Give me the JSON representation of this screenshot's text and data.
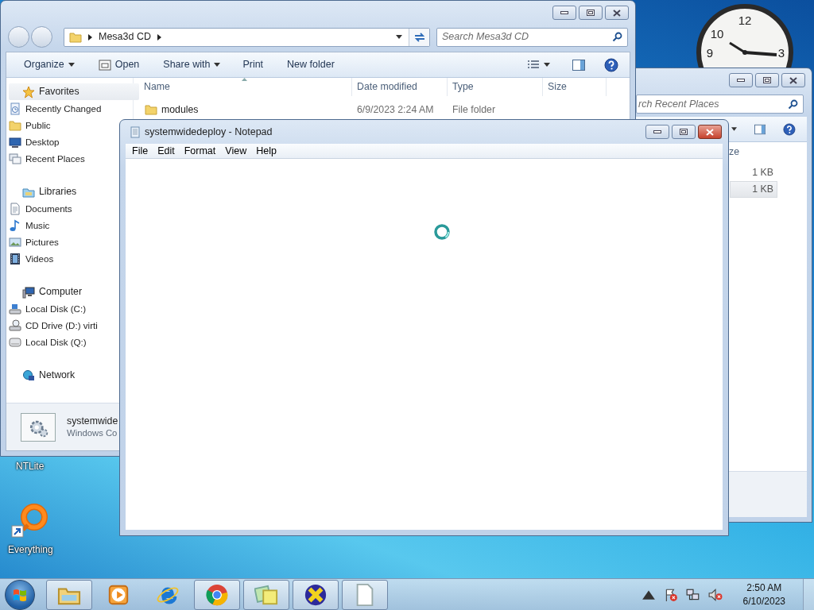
{
  "clock_gadget": {
    "numerals": [
      "12",
      "10",
      "9",
      "3"
    ]
  },
  "explorer": {
    "address": {
      "segments": [
        "Mesa3d CD"
      ]
    },
    "search": {
      "placeholder": "Search Mesa3d CD"
    },
    "commands": [
      {
        "label": "Organize",
        "kind": "menu"
      },
      {
        "label": "Open",
        "kind": "icon"
      },
      {
        "label": "Share with",
        "kind": "menu"
      },
      {
        "label": "Print",
        "kind": "plain"
      },
      {
        "label": "New folder",
        "kind": "plain"
      }
    ],
    "nav": [
      {
        "label": "Favorites",
        "kind": "star",
        "selected": true,
        "children": [
          {
            "label": "Recently Changed",
            "kind": "recent",
            "selected": false
          },
          {
            "label": "Public",
            "kind": "folder",
            "selected": false
          },
          {
            "label": "Desktop",
            "kind": "desktop",
            "selected": false
          },
          {
            "label": "Recent Places",
            "kind": "places",
            "selected": false
          }
        ]
      },
      {
        "label": "Libraries",
        "kind": "library",
        "selected": false,
        "children": [
          {
            "label": "Documents",
            "kind": "document",
            "selected": false
          },
          {
            "label": "Music",
            "kind": "music",
            "selected": false
          },
          {
            "label": "Pictures",
            "kind": "pictures",
            "selected": false
          },
          {
            "label": "Videos",
            "kind": "videos",
            "selected": false
          }
        ]
      },
      {
        "label": "Computer",
        "kind": "computer",
        "selected": false,
        "children": [
          {
            "label": "Local Disk (C:)",
            "kind": "disk",
            "selected": false
          },
          {
            "label": "CD Drive (D:) virti",
            "kind": "cd",
            "selected": false
          },
          {
            "label": "Local Disk (Q:)",
            "kind": "drive",
            "selected": false
          }
        ]
      },
      {
        "label": "Network",
        "kind": "network",
        "selected": false
      }
    ],
    "columns": [
      "Name",
      "Date modified",
      "Type",
      "Size"
    ],
    "rows": [
      {
        "name": "modules",
        "date_modified": "6/9/2023 2:24 AM",
        "type": "File folder"
      }
    ],
    "details": {
      "title": "systemwide",
      "subtitle": "Windows Co"
    }
  },
  "recent_places_window": {
    "search": {
      "placeholder": "rch Recent Places"
    },
    "column": "ze",
    "rows": [
      {
        "size": "1 KB",
        "selected": false
      },
      {
        "size": "1 KB",
        "selected": true
      }
    ]
  },
  "notepad": {
    "title": "systemwidedeploy - Notepad",
    "menu": [
      "File",
      "Edit",
      "Format",
      "View",
      "Help"
    ],
    "busy": true
  },
  "desktop_icons": [
    {
      "label": "NTLite",
      "kind": "covered"
    },
    {
      "label": "Everything",
      "kind": "ring"
    }
  ],
  "taskbar": {
    "apps": [
      {
        "kind": "explorer",
        "running": true
      },
      {
        "kind": "media",
        "running": false
      },
      {
        "kind": "ie",
        "running": false
      },
      {
        "kind": "chrome",
        "running": true
      },
      {
        "kind": "notes",
        "running": true
      },
      {
        "kind": "x",
        "running": true
      },
      {
        "kind": "notepad",
        "running": true
      }
    ],
    "tray": [
      {
        "kind": "arrow"
      },
      {
        "kind": "flag"
      },
      {
        "kind": "network"
      },
      {
        "kind": "speaker"
      }
    ],
    "time": "2:50 AM",
    "date": "6/10/2023"
  }
}
